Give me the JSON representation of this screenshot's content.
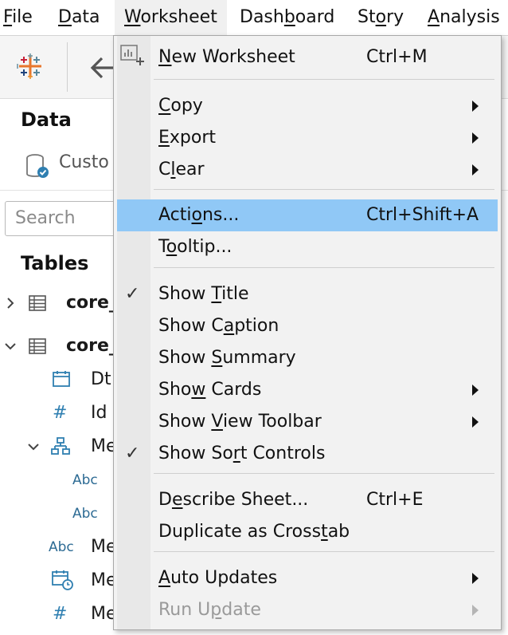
{
  "menubar": {
    "items": [
      {
        "pre": "",
        "u": "F",
        "post": "ile"
      },
      {
        "pre": "",
        "u": "D",
        "post": "ata"
      },
      {
        "pre": "",
        "u": "W",
        "post": "orksheet"
      },
      {
        "pre": "Dash",
        "u": "b",
        "post": "oard"
      },
      {
        "pre": "St",
        "u": "o",
        "post": "ry"
      },
      {
        "pre": "",
        "u": "A",
        "post": "nalysis"
      }
    ]
  },
  "toolbar": {
    "logo_icon": "tableau-logo-icon",
    "back_icon": "back-arrow-icon"
  },
  "sidepanel": {
    "data_heading": "Data",
    "datasource_label": "Custo",
    "search_placeholder": "Search",
    "tables_heading": "Tables",
    "tree": [
      {
        "label": "core_",
        "kind": "table",
        "expanded": false
      },
      {
        "label": "core_",
        "kind": "table",
        "expanded": true
      },
      {
        "label": "Dt",
        "kind": "date"
      },
      {
        "label": "Id",
        "kind": "number"
      },
      {
        "label": "Me",
        "kind": "hierarchy"
      },
      {
        "label": "",
        "kind": "abc"
      },
      {
        "label": "",
        "kind": "abc"
      },
      {
        "label": "Me",
        "kind": "abc"
      },
      {
        "label": "Me",
        "kind": "datetime"
      },
      {
        "label": "Me",
        "kind": "number"
      }
    ],
    "abc_text": "Abc"
  },
  "menu": {
    "new_worksheet": {
      "pre": "",
      "u": "N",
      "post": "ew Worksheet",
      "shortcut": "Ctrl+M"
    },
    "copy": {
      "pre": "",
      "u": "C",
      "post": "opy"
    },
    "export": {
      "pre": "",
      "u": "E",
      "post": "xport"
    },
    "clear": {
      "pre": "C",
      "u": "l",
      "post": "ear"
    },
    "actions": {
      "pre": "Acti",
      "u": "o",
      "post": "ns...",
      "shortcut": "Ctrl+Shift+A"
    },
    "tooltip": {
      "pre": "T",
      "u": "o",
      "post": "oltip..."
    },
    "show_title": {
      "pre": "Show ",
      "u": "T",
      "post": "itle",
      "checked": true
    },
    "show_caption": {
      "pre": "Show C",
      "u": "a",
      "post": "ption"
    },
    "show_summary": {
      "pre": "Show ",
      "u": "S",
      "post": "ummary"
    },
    "show_cards": {
      "pre": "Sho",
      "u": "w",
      "post": " Cards"
    },
    "show_view_toolbar": {
      "pre": "Show ",
      "u": "V",
      "post": "iew Toolbar"
    },
    "show_sort_controls": {
      "pre": "Show So",
      "u": "r",
      "post": "t Controls",
      "checked": true
    },
    "describe_sheet": {
      "pre": "D",
      "u": "e",
      "post": "scribe Sheet...",
      "shortcut": "Ctrl+E"
    },
    "duplicate_crosstab": {
      "pre": "Duplicate as Cross",
      "u": "t",
      "post": "ab"
    },
    "auto_updates": {
      "pre": "",
      "u": "A",
      "post": "uto Updates"
    },
    "run_update": {
      "pre": "Run U",
      "u": "p",
      "post": "date"
    },
    "checkmark": "✓",
    "colors": {
      "highlight": "#90c8f6",
      "disabled": "#9a9a9a"
    }
  }
}
